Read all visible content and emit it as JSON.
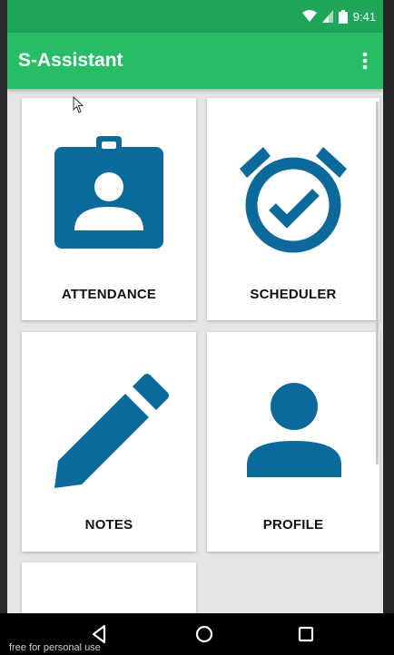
{
  "status_bar": {
    "time": "9:41"
  },
  "app_bar": {
    "title": "S-Assistant",
    "menu_icon": "overflow-menu-icon"
  },
  "cards": [
    {
      "label": "ATTENDANCE",
      "icon": "badge-icon"
    },
    {
      "label": "SCHEDULER",
      "icon": "alarm-clock-check-icon"
    },
    {
      "label": "NOTES",
      "icon": "pencil-icon"
    },
    {
      "label": "PROFILE",
      "icon": "person-icon"
    }
  ],
  "colors": {
    "status_bar": "#1fa65a",
    "app_bar": "#27bd66",
    "icon_blue": "#0c6a9b"
  },
  "watermark": "free for personal use"
}
